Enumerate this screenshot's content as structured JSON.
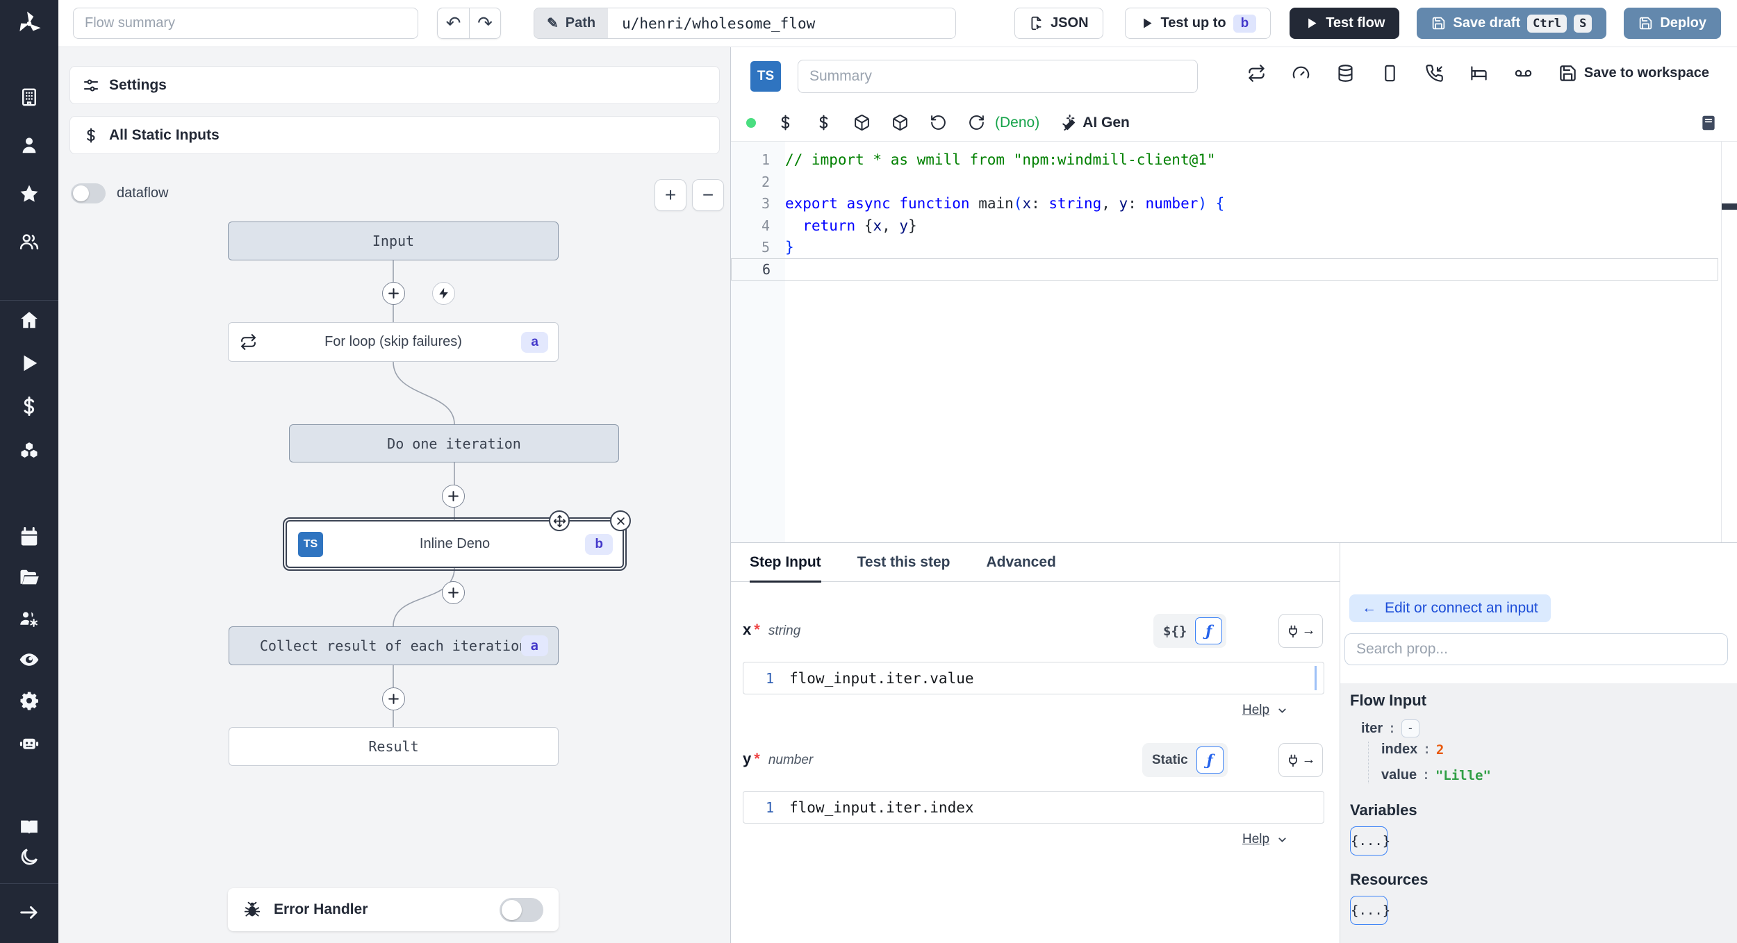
{
  "colors": {
    "sidebar_bg": "#222836",
    "accent_blue": "#3b82f6",
    "steel_button": "#6388ad",
    "dark_button": "#232936",
    "badge_bg": "#e3e8fd",
    "badge_text": "#4338ca",
    "status_dot_green": "#4ade80",
    "runtime_green": "#16a34a",
    "value_number_orange": "#e8590c",
    "value_string_green": "#2f9e44"
  },
  "sidebar": {
    "icons": [
      "windmill-logo",
      "building",
      "user",
      "star",
      "users",
      "home",
      "play",
      "dollar",
      "boxes",
      "calendar",
      "folder-open",
      "users-gear",
      "eye",
      "gear",
      "robot",
      "book-open",
      "moon",
      "expand-arrow"
    ]
  },
  "topbar": {
    "flow_summary_placeholder": "Flow summary",
    "path_label": "Path",
    "path_value": "u/henri/wholesome_flow",
    "json_button": "JSON",
    "test_up_to": "Test up to",
    "test_up_to_badge": "b",
    "test_flow": "Test flow",
    "save_draft": "Save draft",
    "save_draft_kbd_1": "Ctrl",
    "save_draft_kbd_2": "S",
    "deploy": "Deploy"
  },
  "flow_panel": {
    "settings": "Settings",
    "all_static_inputs": "All Static Inputs",
    "dataflow_label": "dataflow",
    "zoom_in": "+",
    "zoom_out": "−",
    "error_handler": "Error Handler",
    "nodes": {
      "input": "Input",
      "for_loop": "For loop (skip failures)",
      "for_loop_badge": "a",
      "do_one_iteration": "Do one iteration",
      "inline_deno": "Inline Deno",
      "inline_deno_badge": "b",
      "inline_deno_lang": "TS",
      "collect": "Collect result of each iteration",
      "collect_badge": "a",
      "result": "Result"
    }
  },
  "editor": {
    "lang_badge": "TS",
    "summary_placeholder": "Summary",
    "save_to_workspace": "Save to workspace",
    "runtime": "(Deno)",
    "ai_gen": "AI Gen",
    "toolbar_icons": [
      "status-dot",
      "dollar",
      "dollar",
      "package",
      "package",
      "rotate-ccw",
      "refresh-cw"
    ],
    "header_icons": [
      "repeat",
      "gauge",
      "database",
      "smartphone",
      "phone-incoming",
      "bed",
      "voicemail"
    ],
    "code": {
      "active_line": 6,
      "lines": [
        {
          "tokens": [
            {
              "t": "// import * as wmill from \"npm:windmill-client@1\"",
              "c": "com"
            }
          ]
        },
        {
          "tokens": []
        },
        {
          "tokens": [
            {
              "t": "export",
              "c": "kw"
            },
            {
              "t": " ",
              "c": "p"
            },
            {
              "t": "async",
              "c": "kw"
            },
            {
              "t": " ",
              "c": "p"
            },
            {
              "t": "function",
              "c": "kw"
            },
            {
              "t": " ",
              "c": "p"
            },
            {
              "t": "main",
              "c": "fn"
            },
            {
              "t": "(",
              "c": "br"
            },
            {
              "t": "x",
              "c": "var"
            },
            {
              "t": ": ",
              "c": "p"
            },
            {
              "t": "string",
              "c": "ty"
            },
            {
              "t": ", ",
              "c": "p"
            },
            {
              "t": "y",
              "c": "var"
            },
            {
              "t": ": ",
              "c": "p"
            },
            {
              "t": "number",
              "c": "ty"
            },
            {
              "t": ")",
              "c": "br"
            },
            {
              "t": " ",
              "c": "p"
            },
            {
              "t": "{",
              "c": "br"
            }
          ]
        },
        {
          "tokens": [
            {
              "t": "  ",
              "c": "p"
            },
            {
              "t": "return",
              "c": "kw"
            },
            {
              "t": " {",
              "c": "p"
            },
            {
              "t": "x",
              "c": "var"
            },
            {
              "t": ", ",
              "c": "p"
            },
            {
              "t": "y",
              "c": "var"
            },
            {
              "t": "}",
              "c": "p"
            }
          ]
        },
        {
          "tokens": [
            {
              "t": "}",
              "c": "br"
            }
          ]
        },
        {
          "tokens": []
        }
      ]
    }
  },
  "step_panel": {
    "tabs": [
      {
        "label": "Step Input",
        "active": true
      },
      {
        "label": "Test this step",
        "active": false
      },
      {
        "label": "Advanced",
        "active": false
      }
    ],
    "x_arg": {
      "name": "x",
      "required": "*",
      "type": "string",
      "mode_alt": "${}",
      "mode_fn": "ƒ",
      "line_no": "1",
      "value": "flow_input.iter.value",
      "help": "Help"
    },
    "y_arg": {
      "name": "y",
      "required": "*",
      "type": "number",
      "mode_alt": "Static",
      "mode_fn": "ƒ",
      "line_no": "1",
      "value": "flow_input.iter.index",
      "help": "Help"
    }
  },
  "props_panel": {
    "edit_connect": "Edit or connect an input",
    "search_placeholder": "Search prop...",
    "flow_input_title": "Flow Input",
    "tree": {
      "iter_key": "iter",
      "iter_value": "-",
      "index_key": "index",
      "index_value": "2",
      "value_key": "value",
      "value_value": "\"Lille\""
    },
    "variables_title": "Variables",
    "variables_btn": "{...}",
    "resources_title": "Resources",
    "resources_btn": "{...}"
  }
}
